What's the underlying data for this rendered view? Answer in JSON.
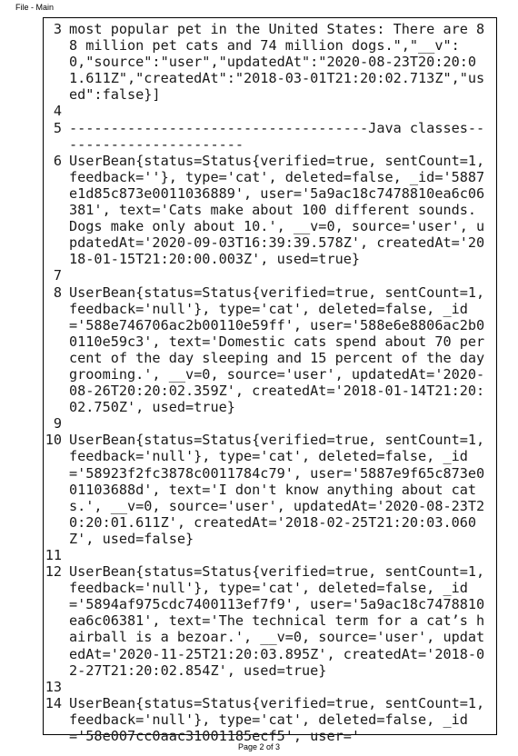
{
  "header": {
    "title": "File - Main"
  },
  "lines": [
    {
      "num": "3",
      "text": "most popular pet in the United States: There are 88 million pet cats and 74 million dogs.\",\"__v\":0,\"source\":\"user\",\"updatedAt\":\"2020-08-23T20:20:01.611Z\",\"createdAt\":\"2018-03-01T21:20:02.713Z\",\"used\":false}]"
    },
    {
      "num": "4",
      "text": ""
    },
    {
      "num": "5",
      "text": "------------------------------------Java classes-----------------------"
    },
    {
      "num": "6",
      "text": "UserBean{status=Status{verified=true, sentCount=1, feedback=''}, type='cat', deleted=false, _id='5887e1d85c873e0011036889', user='5a9ac18c7478810ea6c06381', text='Cats make about 100 different sounds. Dogs make only about 10.', __v=0, source='user', updatedAt='2020-09-03T16:39:39.578Z', createdAt='2018-01-15T21:20:00.003Z', used=true}"
    },
    {
      "num": "7",
      "text": ""
    },
    {
      "num": "8",
      "text": "UserBean{status=Status{verified=true, sentCount=1, feedback='null'}, type='cat', deleted=false, _id='588e746706ac2b00110e59ff', user='588e6e8806ac2b00110e59c3', text='Domestic cats spend about 70 percent of the day sleeping and 15 percent of the day grooming.', __v=0, source='user', updatedAt='2020-08-26T20:20:02.359Z', createdAt='2018-01-14T21:20:02.750Z', used=true}"
    },
    {
      "num": "9",
      "text": ""
    },
    {
      "num": "10",
      "text": "UserBean{status=Status{verified=true, sentCount=1, feedback='null'}, type='cat', deleted=false, _id='58923f2fc3878c0011784c79', user='5887e9f65c873e001103688d', text='I don't know anything about cats.', __v=0, source='user', updatedAt='2020-08-23T20:20:01.611Z', createdAt='2018-02-25T21:20:03.060Z', used=false}"
    },
    {
      "num": "11",
      "text": ""
    },
    {
      "num": "12",
      "text": "UserBean{status=Status{verified=true, sentCount=1, feedback='null'}, type='cat', deleted=false, _id='5894af975cdc7400113ef7f9', user='5a9ac18c7478810ea6c06381', text='The technical term for a cat’s hairball is a bezoar.', __v=0, source='user', updatedAt='2020-11-25T21:20:03.895Z', createdAt='2018-02-27T21:20:02.854Z', used=true}"
    },
    {
      "num": "13",
      "text": ""
    },
    {
      "num": "14",
      "text": "UserBean{status=Status{verified=true, sentCount=1, feedback='null'}, type='cat', deleted=false, _id='58e007cc0aac31001185ecf5', user='"
    }
  ],
  "footer": {
    "page_label": "Page 2 of 3"
  }
}
